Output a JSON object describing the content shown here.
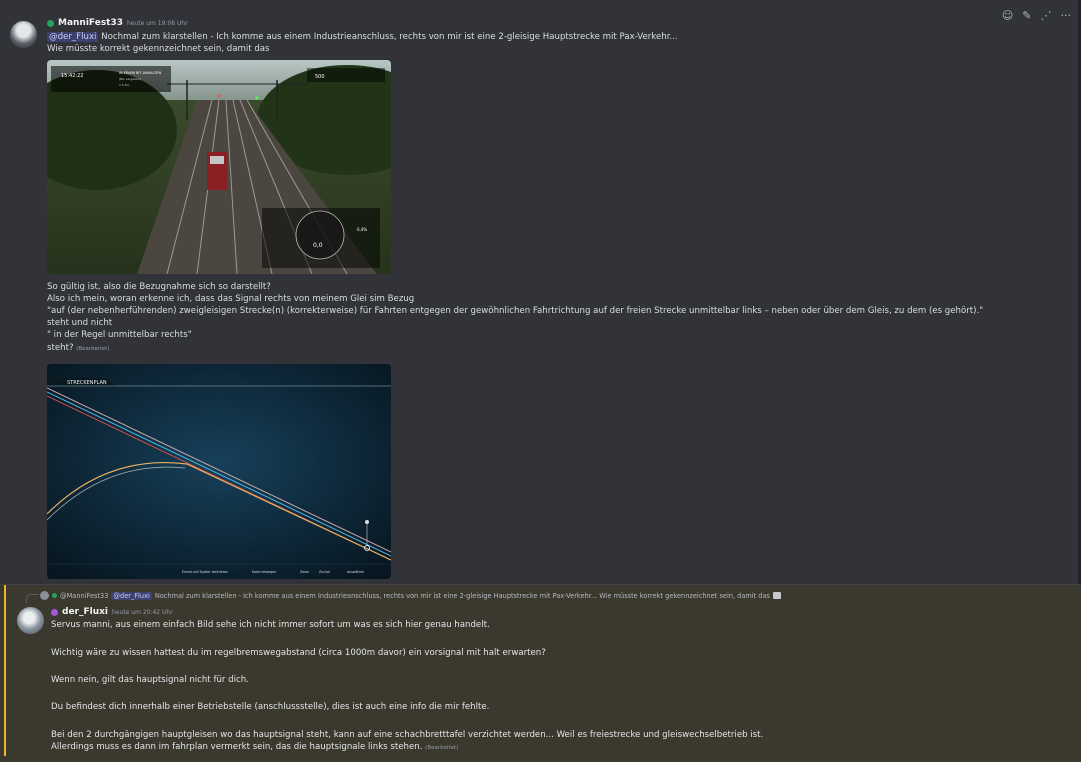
{
  "toolbar": {
    "icons": [
      "emoji-icon",
      "edit-icon",
      "thread-icon",
      "more-icon"
    ],
    "more_label": "···"
  },
  "message1": {
    "username": "ManniFest33",
    "timestamp": "heute um 19:08 Uhr",
    "mention": "@der_Fluxi",
    "line1_text": " Nochmal zum klarstellen - Ich komme aus einem Industrieanschluss, rechts von mir ist eine 2-gleisige Hauptstrecke mit Pax-Verkehr...",
    "line2": "Wie müsste korrekt gekennzeichnet sein, damit das",
    "image1": {
      "clock": "15:42:22",
      "info_title": "IN EINEM BIT ANHALTEN",
      "info_sub": "(Bis vergeben)",
      "dist": "1,5 km",
      "speed_limit": "500",
      "speed_value": "0,0",
      "percent": "0,4%"
    },
    "lines": [
      "So gültig ist, also die Bezugnahme sich so darstellt?",
      "Also ich mein, woran erkenne ich, dass das Signal rechts von meinem Glei sim Bezug",
      "\"auf (der nebenherführenden) zweigleisigen Strecke(n) (korrekterweise) für Fahrten entgegen der gewöhnlichen Fahrtrichtung auf der freien Strecke unmittelbar links – neben oder über dem Gleis, zu dem (es gehört).\"",
      "steht und nicht",
      "\" in der Regel unmittelbar rechts\""
    ],
    "last_line": "steht?",
    "edited": "(Bearbeitet)",
    "image2": {
      "title": "STRECKENPLAN",
      "controls": [
        "Erneut auf Spieler zentrieren",
        "Karte bewegen",
        "Zoom",
        "Zurück",
        "Auswählen"
      ]
    }
  },
  "reply": {
    "ref_user": "@ManniFest33",
    "ref_mention": "@der_Fluxi",
    "ref_text": " Nochmal zum klarstellen - Ich komme aus einem Industrieanschluss, rechts von mir ist eine 2-gleisige Hauptstrecke mit Pax-Verkehr... Wie müsste korrekt gekennzeichnet sein, damit das",
    "username": "der_Fluxi",
    "timestamp": "heute um 20:42 Uhr",
    "lines": [
      "Servus manni, aus einem einfach Bild sehe ich nicht immer sofort um was es sich hier genau handelt.",
      "Wichtig wäre zu wissen hattest du im regelbremswegabstand (circa 1000m davor) ein vorsignal mit halt erwarten?",
      "Wenn nein, gilt das hauptsignal nicht für dich.",
      "Du befindest dich innerhalb einer Betriebstelle  (anschlussstelle), dies ist auch eine info die mir fehlte.",
      "Bei den 2 durchgängigen hauptgleisen wo das hauptsignal steht, kann auf eine schachbretttafel verzichtet werden... Weil es freiestrecke und gleiswechselbetrieb ist."
    ],
    "last_line": "Allerdings muss es dann im fahrplan   vermerkt sein, das die hauptsignale links stehen.",
    "edited": "(Bearbeitet)"
  }
}
